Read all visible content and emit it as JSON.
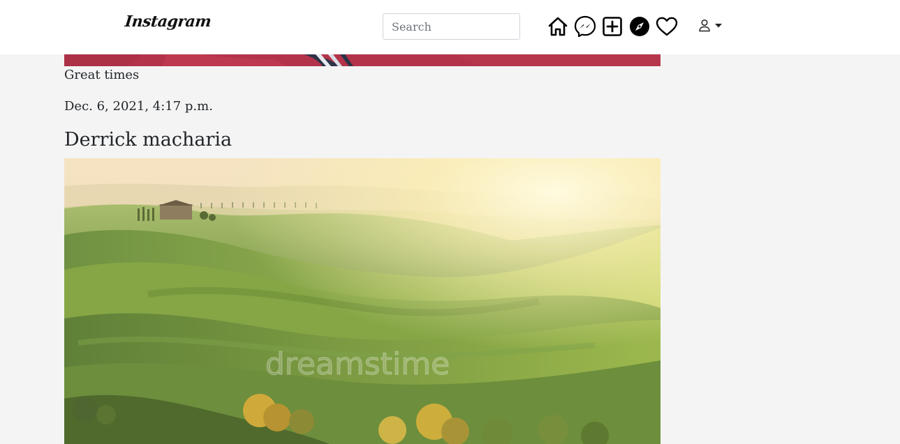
{
  "navbar": {
    "brand": "Instagram",
    "search_placeholder": "Search",
    "icons": [
      "home-icon",
      "messenger-icon",
      "add-post-icon",
      "explore-icon",
      "heart-icon",
      "user-icon",
      "caret-down-icon"
    ]
  },
  "feed": {
    "previous_post": {
      "caption": "Great times",
      "timestamp": "Dec. 6, 2021, 4:17 p.m."
    },
    "current_post": {
      "author": "Derrick macharia",
      "image_watermark": "dreamstime"
    }
  },
  "colors": {
    "navbar_bg": "#ffffff",
    "page_bg": "#f4f4f4",
    "text": "#212529",
    "prev_photo_tone": "#b4344a"
  }
}
